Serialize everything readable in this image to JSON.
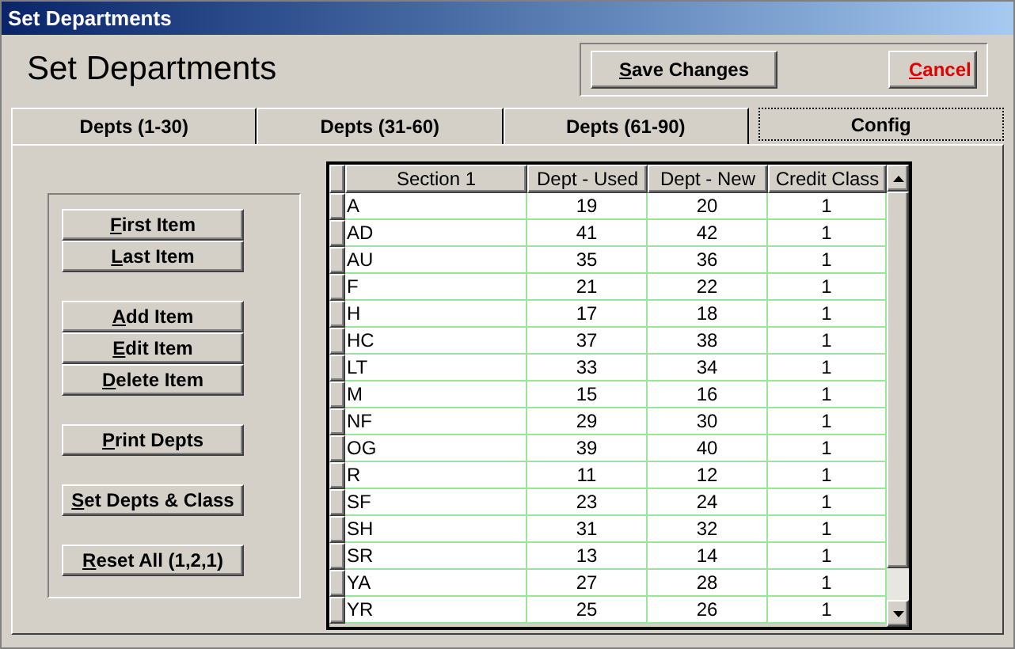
{
  "window": {
    "title": "Set Departments"
  },
  "heading": "Set Departments",
  "top_buttons": [
    {
      "label": "Save Changes",
      "kind": "normal"
    },
    {
      "label": "Cancel",
      "kind": "danger"
    }
  ],
  "tabs": [
    {
      "label": "Depts (1-30)",
      "selected": false
    },
    {
      "label": "Depts (31-60)",
      "selected": false
    },
    {
      "label": "Depts (61-90)",
      "selected": false
    },
    {
      "label": "Config",
      "selected": true
    }
  ],
  "side_button_groups": [
    [
      "First Item",
      "Last Item"
    ],
    [
      "Add Item",
      "Edit Item",
      "Delete Item"
    ],
    [
      "Print Depts"
    ],
    [
      "Set Depts & Class"
    ],
    [
      "Reset All (1,2,1)"
    ]
  ],
  "table": {
    "columns": [
      "Section 1",
      "Dept - Used",
      "Dept - New",
      "Credit Class"
    ],
    "rows": [
      [
        "A",
        "19",
        "20",
        "1"
      ],
      [
        "AD",
        "41",
        "42",
        "1"
      ],
      [
        "AU",
        "35",
        "36",
        "1"
      ],
      [
        "F",
        "21",
        "22",
        "1"
      ],
      [
        "H",
        "17",
        "18",
        "1"
      ],
      [
        "HC",
        "37",
        "38",
        "1"
      ],
      [
        "LT",
        "33",
        "34",
        "1"
      ],
      [
        "M",
        "15",
        "16",
        "1"
      ],
      [
        "NF",
        "29",
        "30",
        "1"
      ],
      [
        "OG",
        "39",
        "40",
        "1"
      ],
      [
        "R",
        "11",
        "12",
        "1"
      ],
      [
        "SF",
        "23",
        "24",
        "1"
      ],
      [
        "SH",
        "31",
        "32",
        "1"
      ],
      [
        "SR",
        "13",
        "14",
        "1"
      ],
      [
        "YA",
        "27",
        "28",
        "1"
      ],
      [
        "YR",
        "25",
        "26",
        "1"
      ]
    ]
  }
}
